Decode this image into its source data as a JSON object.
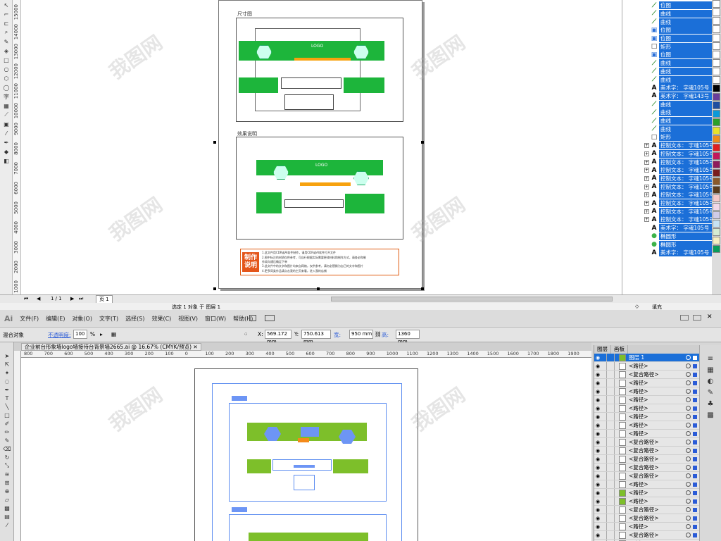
{
  "corel": {
    "vruler_ticks": [
      "15000",
      "14000",
      "13000",
      "12000",
      "11000",
      "10000",
      "9000",
      "8000",
      "7000",
      "6000",
      "5000",
      "4000",
      "3000",
      "2000",
      "1000"
    ],
    "sections": [
      {
        "title": "尺寸图"
      },
      {
        "title": "效果说明"
      }
    ],
    "logo_text": "LOGO",
    "note_label": "制作说明",
    "note_lines": [
      "1.此文件用CDR或AI软件制作，请用CDR或AI软件打开文件",
      "2.图中标注的材质仅供参考，可自行根据实际需要更改材料和制作方式，请各必和制",
      "  作商沟通后确定下单",
      "3.此文件中的文字和图片均来自网络，仅供参考，请勿必替换为自己的文字和图片",
      "4.更多同类作品请点击我的主页来看，进入我的店铺"
    ],
    "bottom_bar": {
      "page_counter": "1 / 1",
      "page_tab": "页 1"
    },
    "status_text": "选定 1 对象 于 图层 1",
    "fill_label": "填充",
    "objects": [
      {
        "icon": "curve",
        "label": "位图"
      },
      {
        "icon": "curve",
        "label": "曲线"
      },
      {
        "icon": "curve",
        "label": "曲线"
      },
      {
        "icon": "bitmap",
        "label": "位图"
      },
      {
        "icon": "bitmap",
        "label": "位图"
      },
      {
        "icon": "rect",
        "label": "矩形"
      },
      {
        "icon": "bitmap",
        "label": "位图"
      },
      {
        "icon": "curve",
        "label": "曲线"
      },
      {
        "icon": "curve",
        "label": "曲线"
      },
      {
        "icon": "curve",
        "label": "曲线"
      },
      {
        "icon": "A",
        "label": "美术字： 字魂105号"
      },
      {
        "icon": "A",
        "label": "美术字： 字魂143号"
      },
      {
        "icon": "curve",
        "label": "曲线"
      },
      {
        "icon": "curve",
        "label": "曲线"
      },
      {
        "icon": "curve",
        "label": "曲线"
      },
      {
        "icon": "curve",
        "label": "曲线"
      },
      {
        "icon": "rect",
        "label": "矩形"
      },
      {
        "icon": "A",
        "label": "控制文本： 字魂105号"
      },
      {
        "icon": "A",
        "label": "控制文本： 字魂105号"
      },
      {
        "icon": "A",
        "label": "控制文本： 字魂105号"
      },
      {
        "icon": "A",
        "label": "控制文本： 字魂105号"
      },
      {
        "icon": "A",
        "label": "控制文本： 字魂105号"
      },
      {
        "icon": "A",
        "label": "控制文本： 字魂105号"
      },
      {
        "icon": "A",
        "label": "控制文本： 字魂105号"
      },
      {
        "icon": "A",
        "label": "控制文本： 字魂105号"
      },
      {
        "icon": "A",
        "label": "控制文本： 字魂105号"
      },
      {
        "icon": "A",
        "label": "控制文本： 字魂105号"
      },
      {
        "icon": "A",
        "label": "美术字： 字魂105号"
      },
      {
        "icon": "ellipse",
        "label": "椭圆形"
      },
      {
        "icon": "ellipse",
        "label": "椭圆形"
      },
      {
        "icon": "A",
        "label": "美术字： 字魂105号"
      }
    ],
    "palette": [
      "#ffffff",
      "#ffffff",
      "#ffffff",
      "#ffffff",
      "#ffffff",
      "#ffffff",
      "#ffffff",
      "#ffffff",
      "#ffffff",
      "#ffffff",
      "#000000",
      "#6a3d9a",
      "#1f4ea0",
      "#0d9ad8",
      "#2aa02a",
      "#e8e22a",
      "#f08c1a",
      "#e02020",
      "#c2185b",
      "#8e1d5c",
      "#7a1e1e",
      "#8a5a2b",
      "#5a3c1e",
      "#f5c9c9",
      "#f2d8e8",
      "#d0cce8",
      "#c7e2f2",
      "#d6ecd2",
      "#f6efc2",
      "#0a9c5a"
    ]
  },
  "ai": {
    "app_logo": "Ai",
    "menus": [
      "文件(F)",
      "编辑(E)",
      "对象(O)",
      "文字(T)",
      "选择(S)",
      "效果(C)",
      "视图(V)",
      "窗口(W)",
      "帮助(H)"
    ],
    "control": {
      "mixed_label": "混合对象",
      "opacity_label": "不透明度:",
      "opacity_value": "100",
      "opacity_unit": "%",
      "x_label": "X:",
      "x_value": "569.172 mm",
      "y_label": "Y:",
      "y_value": "750.613 mm",
      "w_label": "宽:",
      "w_value": "950 mm",
      "h_label": "高:",
      "h_value": "1360 mm"
    },
    "doc_tab": "企业前台形象墙logo墙接待台背景墙2665.ai @ 16.67% (CMYK/预览)",
    "hruler_ticks": [
      "800",
      "700",
      "600",
      "500",
      "400",
      "300",
      "200",
      "100",
      "0",
      "100",
      "200",
      "300",
      "400",
      "500",
      "600",
      "700",
      "800",
      "900",
      "1000",
      "1100",
      "1200",
      "1300",
      "1400",
      "1500",
      "1600",
      "1700",
      "1800",
      "1900"
    ],
    "layers_tabs": [
      "图层",
      "画板"
    ],
    "layer_name": "图层 1",
    "layer_rows": [
      {
        "name": "<路径>",
        "thumb": "#ffffff"
      },
      {
        "name": "<复合路径>",
        "thumb": "#ffffff"
      },
      {
        "name": "<路径>",
        "thumb": "#ffffff"
      },
      {
        "name": "<路径>",
        "thumb": "#ffffff"
      },
      {
        "name": "<路径>",
        "thumb": "#ffffff"
      },
      {
        "name": "<路径>",
        "thumb": "#ffffff"
      },
      {
        "name": "<路径>",
        "thumb": "#ffffff"
      },
      {
        "name": "<路径>",
        "thumb": "#ffffff"
      },
      {
        "name": "<路径>",
        "thumb": "#ffffff"
      },
      {
        "name": "<复合路径>",
        "thumb": "#ffffff"
      },
      {
        "name": "<复合路径>",
        "thumb": "#ffffff"
      },
      {
        "name": "<复合路径>",
        "thumb": "#ffffff"
      },
      {
        "name": "<复合路径>",
        "thumb": "#ffffff"
      },
      {
        "name": "<复合路径>",
        "thumb": "#ffffff"
      },
      {
        "name": "<路径>",
        "thumb": "#ffffff"
      },
      {
        "name": "<路径>",
        "thumb": "#7dbf2a"
      },
      {
        "name": "<路径>",
        "thumb": "#7dbf2a"
      },
      {
        "name": "<复合路径>",
        "thumb": "#ffffff"
      },
      {
        "name": "<复合路径>",
        "thumb": "#ffffff"
      },
      {
        "name": "<路径>",
        "thumb": "#ffffff"
      },
      {
        "name": "<复合路径>",
        "thumb": "#ffffff"
      },
      {
        "name": "<路径>",
        "thumb": "#ffffff"
      }
    ]
  },
  "watermark": "我图网"
}
